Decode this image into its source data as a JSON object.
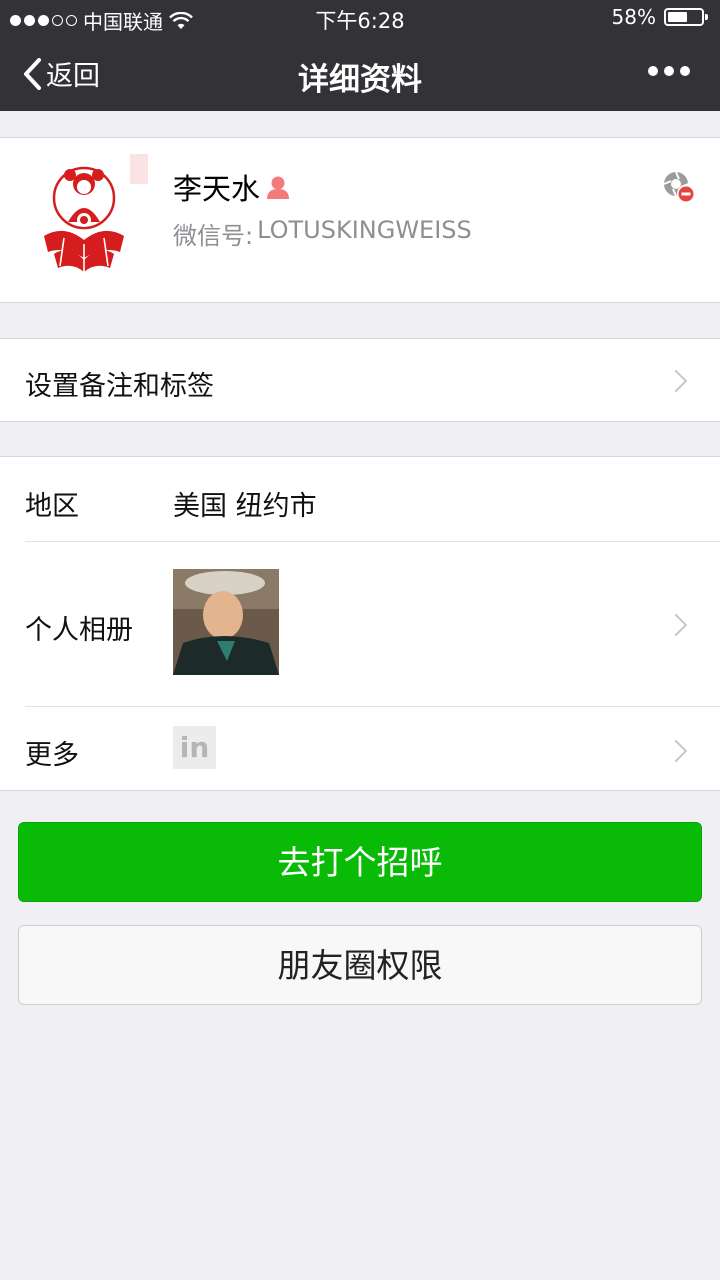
{
  "status_bar": {
    "carrier": "中国联通",
    "time": "下午6:28",
    "battery_text": "58%",
    "battery_level": 0.58
  },
  "nav": {
    "back_label": "返回",
    "title": "详细资料"
  },
  "profile": {
    "name": "李天水",
    "wechat_id_label": "微信号:",
    "wechat_id": "LOTUSKINGWEISS"
  },
  "remark_row": {
    "label": "设置备注和标签"
  },
  "info": {
    "region_label": "地区",
    "region_value": "美国 纽约市",
    "album_label": "个人相册",
    "more_label": "更多",
    "more_icon_text": "in"
  },
  "buttons": {
    "greet": "去打个招呼",
    "moments_permission": "朋友圈权限"
  },
  "colors": {
    "nav_bg": "#323237",
    "page_bg": "#efeff4",
    "primary_green": "#09bb07",
    "female_icon": "#f37b7b"
  }
}
